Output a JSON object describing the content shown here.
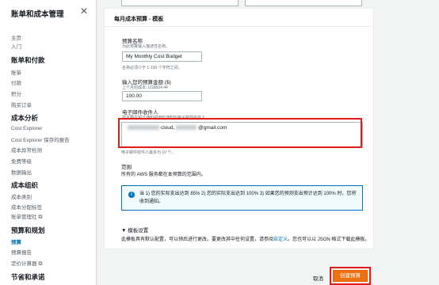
{
  "sidebar": {
    "title": "账单和成本管理",
    "close_icon": "close-icon",
    "items": [
      {
        "type": "item",
        "label": "主页"
      },
      {
        "type": "item",
        "label": "入门"
      },
      {
        "type": "section",
        "label": "账单和付款"
      },
      {
        "type": "item",
        "label": "账单"
      },
      {
        "type": "item",
        "label": "付款"
      },
      {
        "type": "item",
        "label": "积分"
      },
      {
        "type": "item",
        "label": "购买订单"
      },
      {
        "type": "section",
        "label": "成本分析"
      },
      {
        "type": "item",
        "label": "Cost Explorer"
      },
      {
        "type": "item",
        "label": "Cost Explorer 保存的报告"
      },
      {
        "type": "item",
        "label": "成本异常检测"
      },
      {
        "type": "item",
        "label": "免费等级"
      },
      {
        "type": "item",
        "label": "数据输出"
      },
      {
        "type": "section",
        "label": "成本组织"
      },
      {
        "type": "item",
        "label": "成本类别"
      },
      {
        "type": "item",
        "label": "成本分配标签"
      },
      {
        "type": "item",
        "label": "账单管理社"
      },
      {
        "type": "section",
        "label": "预算和规划"
      },
      {
        "type": "item",
        "label": "预算"
      },
      {
        "type": "item",
        "label": "预算报告"
      },
      {
        "type": "item",
        "label": "定价计算器"
      },
      {
        "type": "section",
        "label": "节省和承诺"
      }
    ]
  },
  "form": {
    "card_title": "每月成本预算 - 模板",
    "budget_name_label": "预算名称",
    "budget_name_desc": "为此预算输入描述性名称。",
    "budget_name_value": "My Monthly Cost Budget",
    "budget_name_hint": "名称必须介于 1-100 个字符之间。",
    "amount_label": "输入您的预算金额 ($)",
    "amount_desc": "上个月的成本: US$604.44",
    "amount_value": "100.00",
    "email_label": "电子邮件收件人",
    "email_desc": "指定要在超过通知阈值时通知的电子邮件收件人。",
    "email_value_visible_1": "cloud,",
    "email_value_visible_2": "@gmail.com",
    "email_hint": "电子邮件收件人最多为 10 个。",
    "scope_label": "范围",
    "scope_desc": "所有的 AWS 服务都在本预算的范围内。",
    "info_text": "当 1) 您的实际支出达到 85% 2) 您的实际支出达到 100% 3) 如果您的预测支出预计达到 100% 时，您将收到通知。",
    "info_icon": "info-icon",
    "template_toggle": "▼ 模板设置",
    "template_desc_1": "此模板具有默认配置，可以预后进行更改。要更改其中任何设置，请参阅",
    "template_desc_link": "自定义",
    "template_desc_2": "。您也可以以 JSON 格式下载此模板。"
  },
  "footer": {
    "cancel_label": "取消",
    "create_label": "创建预算"
  },
  "colors": {
    "accent": "#0073bb",
    "primary_button": "#ec7211",
    "highlight": "#e11a1a"
  }
}
